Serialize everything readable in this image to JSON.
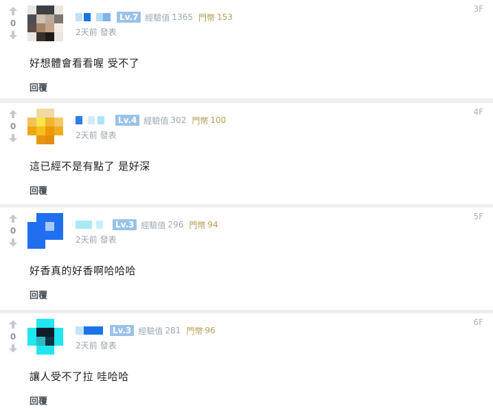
{
  "comments": [
    {
      "floor": "3F",
      "score": "0",
      "level": "Lv.7",
      "exp_label": "經驗值",
      "exp_value": "1365",
      "coin_label": "門幣",
      "coin_value": "153",
      "time": "2天前",
      "action": "發表",
      "text": "好想體會看看喔 受不了",
      "reply": "回覆"
    },
    {
      "floor": "4F",
      "score": "0",
      "level": "Lv.4",
      "exp_label": "經驗值",
      "exp_value": "302",
      "coin_label": "門幣",
      "coin_value": "100",
      "time": "2天前",
      "action": "發表",
      "text": "這已經不是有點了 是好深",
      "reply": "回覆"
    },
    {
      "floor": "5F",
      "score": "0",
      "level": "Lv.3",
      "exp_label": "經驗值",
      "exp_value": "296",
      "coin_label": "門幣",
      "coin_value": "94",
      "time": "2天前",
      "action": "發表",
      "text": "好香真的好香啊哈哈哈",
      "reply": "回覆"
    },
    {
      "floor": "6F",
      "score": "0",
      "level": "Lv.3",
      "exp_label": "經驗值",
      "exp_value": "281",
      "coin_label": "門幣",
      "coin_value": "96",
      "time": "2天前",
      "action": "發表",
      "text": "讓人受不了拉 哇哈哈",
      "reply": "回覆"
    }
  ],
  "colors": {
    "background": "#eeeeee",
    "card": "#ffffff",
    "level_badge": "#9ac2e9",
    "exp_text": "#9aa8b5",
    "coin_text": "#b69d56",
    "reply_text": "#4b5257"
  },
  "icons": {
    "upvote": "arrow-up-icon",
    "downvote": "arrow-down-icon"
  }
}
